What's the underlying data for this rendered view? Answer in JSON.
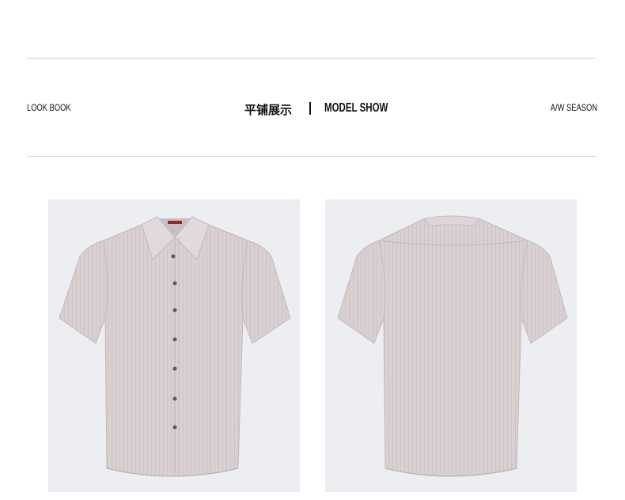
{
  "header": {
    "left_label": "LOOK BOOK",
    "center_cn": "平铺展示",
    "center_en": "MODEL SHOW",
    "right_label": "A/W SEASON"
  },
  "photos": [
    {
      "view": "front",
      "icon": "shirt-front-icon"
    },
    {
      "view": "back",
      "icon": "shirt-back-icon"
    }
  ],
  "colors": {
    "shirt": "#d9d0d2",
    "shirt_shadow": "#c7bcbf",
    "stripe": "#cbc0c3",
    "photo_bg": "#eceef2",
    "rule": "#cfcfcf",
    "button": "#5a5a60"
  }
}
